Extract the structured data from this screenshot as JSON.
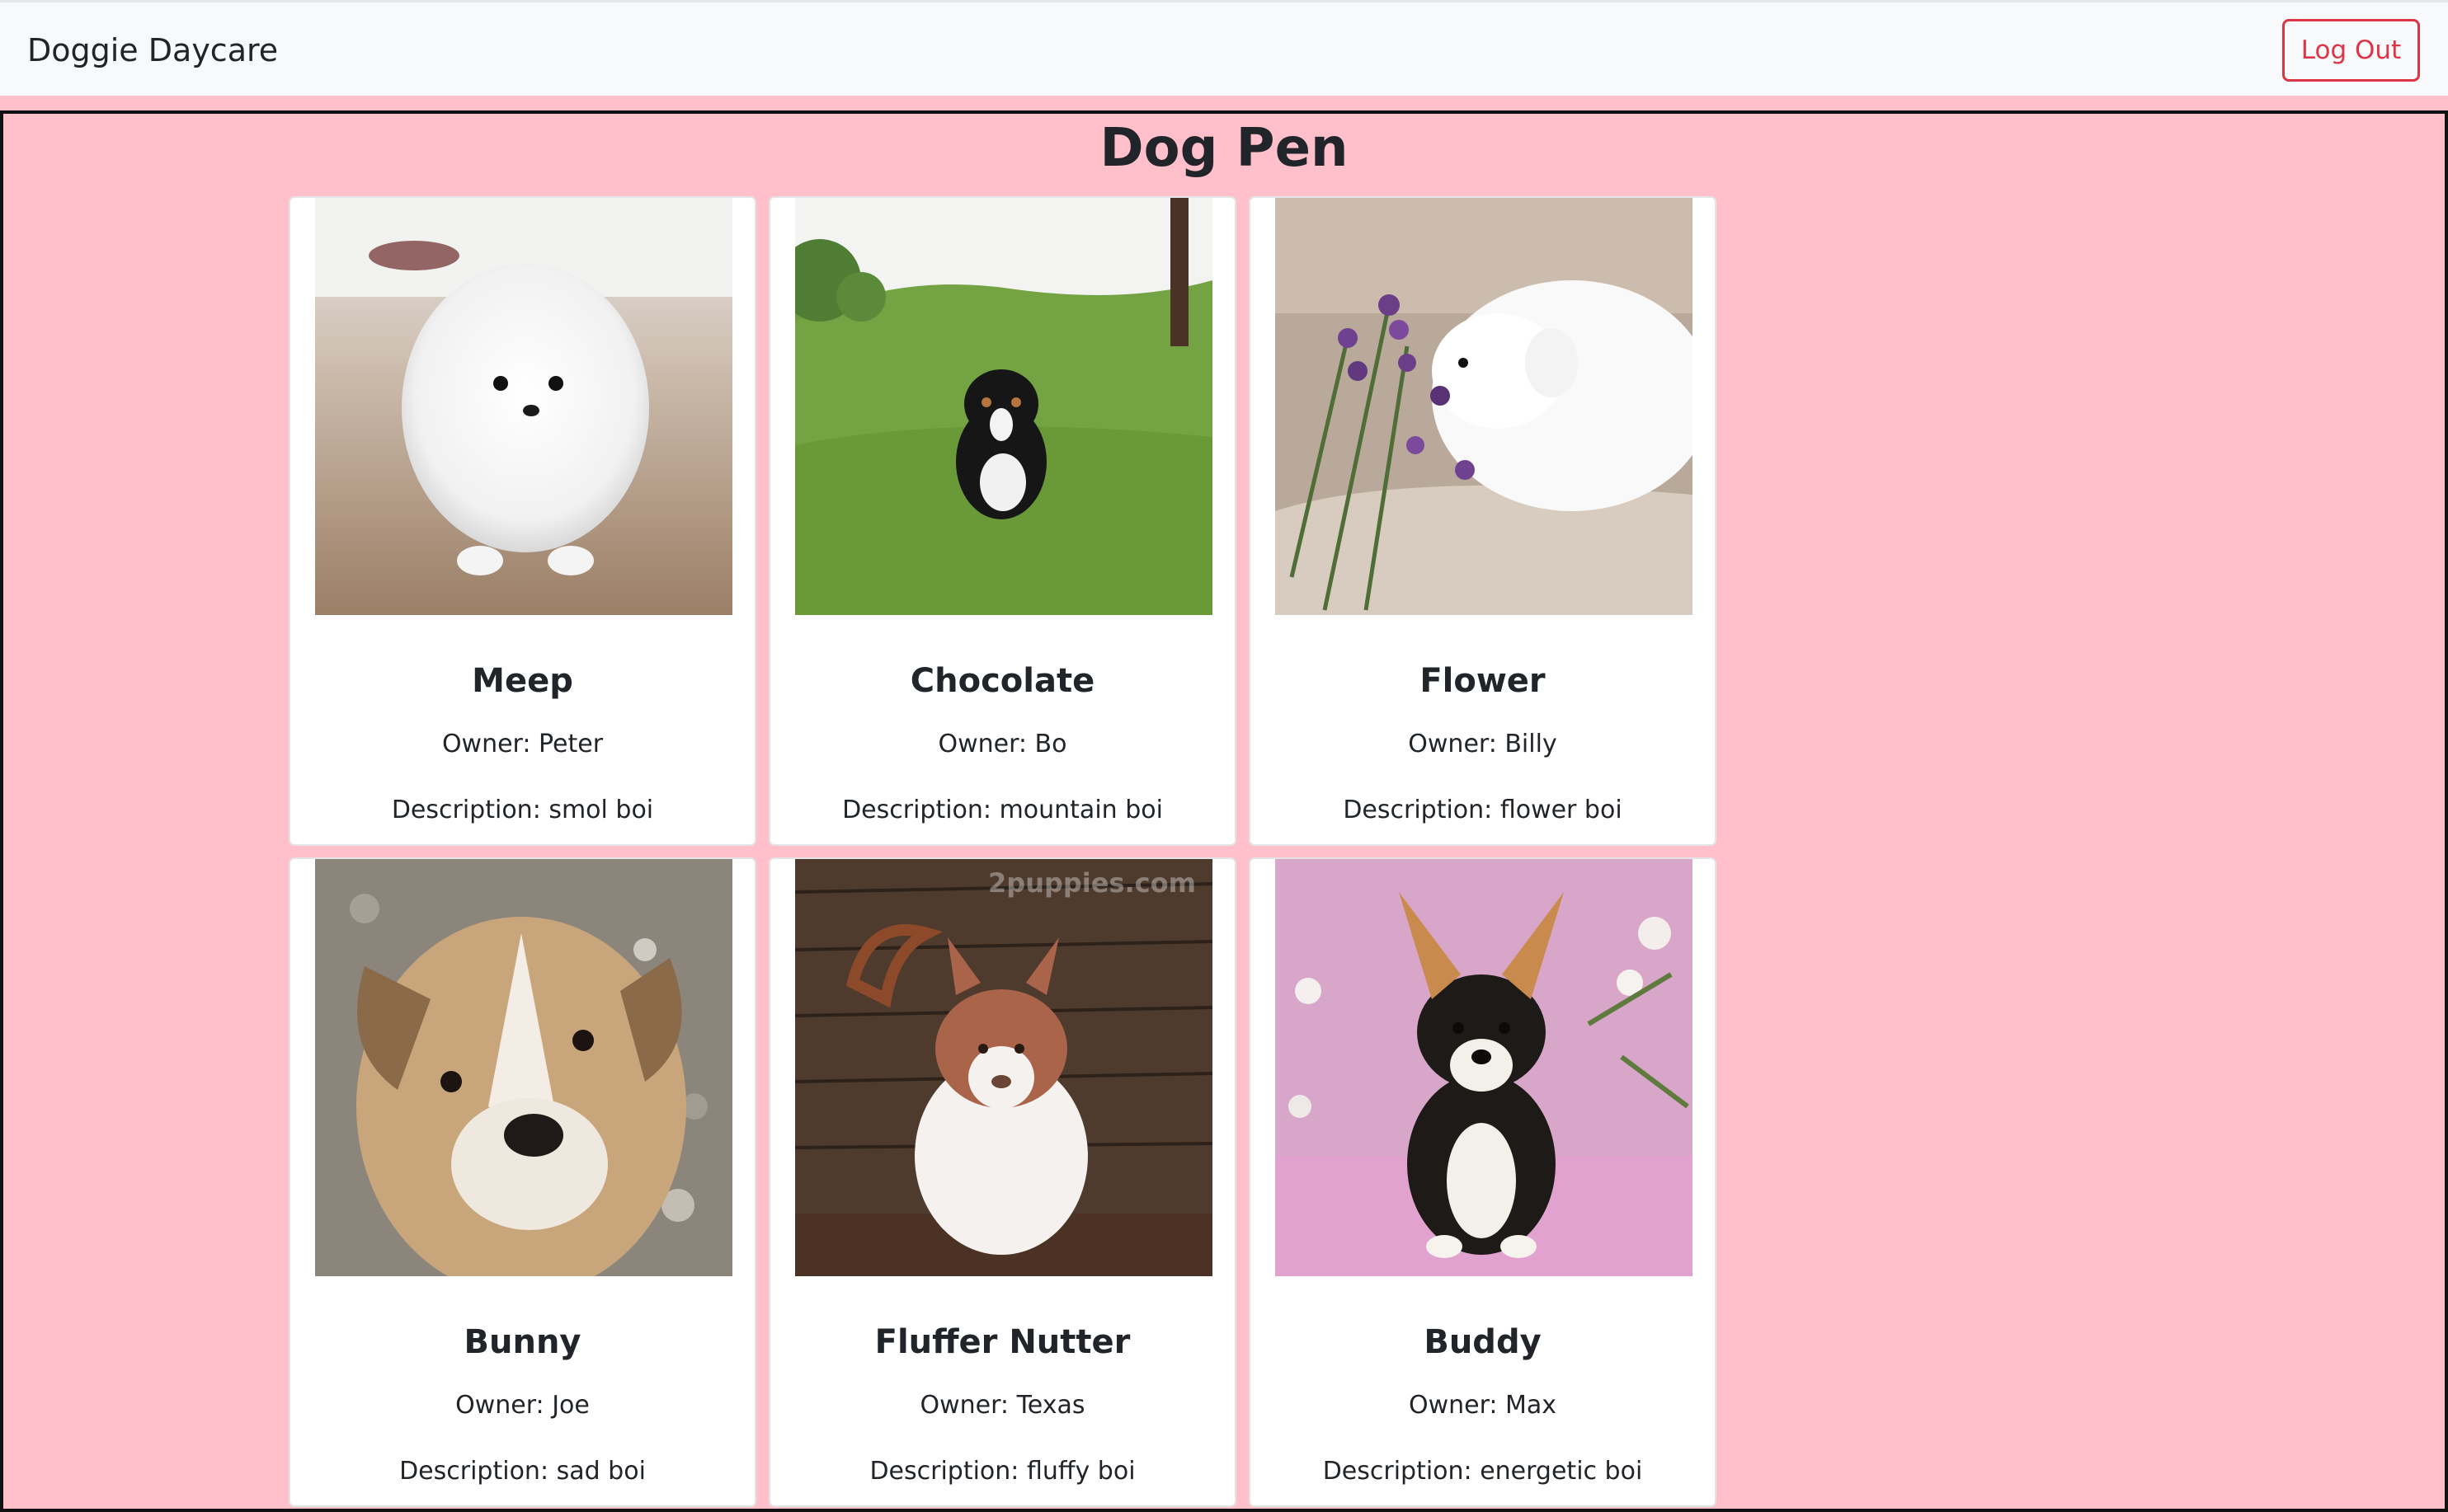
{
  "navbar": {
    "brand": "Doggie Daycare",
    "logout_label": "Log Out"
  },
  "page": {
    "title": "Dog Pen"
  },
  "dogs": [
    {
      "name": "Meep",
      "owner": "Owner: Peter",
      "description": "Description: smol boi"
    },
    {
      "name": "Chocolate",
      "owner": "Owner: Bo",
      "description": "Description: mountain boi"
    },
    {
      "name": "Flower",
      "owner": "Owner: Billy",
      "description": "Description: flower boi"
    },
    {
      "name": "Bunny",
      "owner": "Owner: Joe",
      "description": "Description: sad boi"
    },
    {
      "name": "Fluffer Nutter",
      "owner": "Owner: Texas",
      "description": "Description: fluffy boi"
    },
    {
      "name": "Buddy",
      "owner": "Owner: Max",
      "description": "Description: energetic boi"
    }
  ],
  "photo_overlay_text": "2puppies.com",
  "colors": {
    "background": "#ffc0cb",
    "navbar": "#f8f9fa",
    "danger": "#dc3545",
    "text": "#212529"
  }
}
